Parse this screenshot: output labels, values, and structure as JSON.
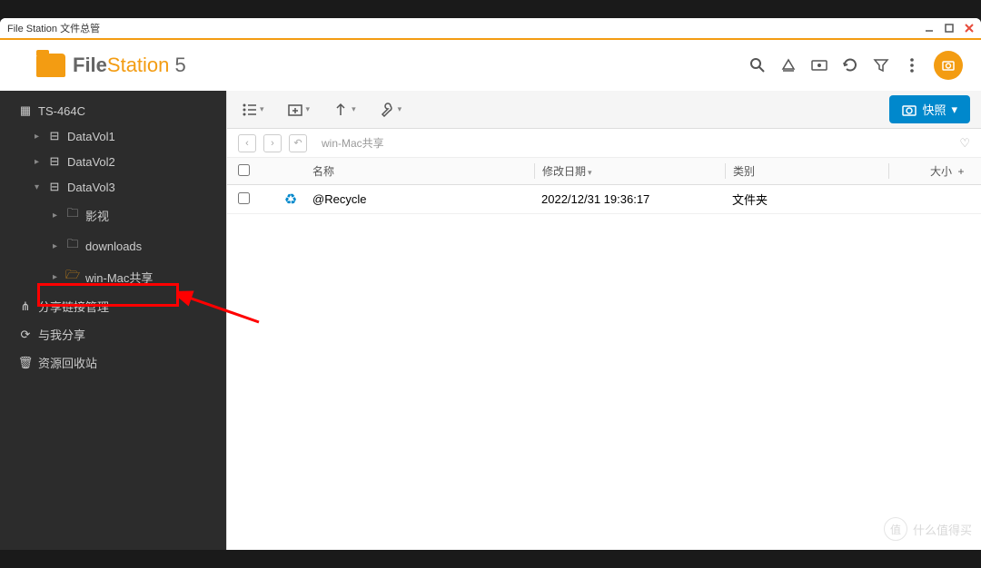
{
  "window": {
    "title": "File Station 文件总管"
  },
  "logo": {
    "text_bold": "File",
    "text_light": "Station",
    "text_num": " 5"
  },
  "sidebar": {
    "root": "TS-464C",
    "volumes": [
      {
        "label": "DataVol1"
      },
      {
        "label": "DataVol2"
      },
      {
        "label": "DataVol3"
      }
    ],
    "folders": [
      {
        "label": "影视"
      },
      {
        "label": "downloads"
      },
      {
        "label": "win-Mac共享"
      }
    ],
    "share_mgmt": "分享链接管理",
    "shared_with_me": "与我分享",
    "recycle_bin": "资源回收站"
  },
  "toolbar": {
    "snapshot": "快照"
  },
  "breadcrumb": {
    "path": "win-Mac共享"
  },
  "table": {
    "headers": {
      "name": "名称",
      "date": "修改日期",
      "type": "类别",
      "size": "大小"
    },
    "rows": [
      {
        "name": "@Recycle",
        "date": "2022/12/31 19:36:17",
        "type": "文件夹",
        "size": ""
      }
    ]
  },
  "watermark": "什么值得买"
}
